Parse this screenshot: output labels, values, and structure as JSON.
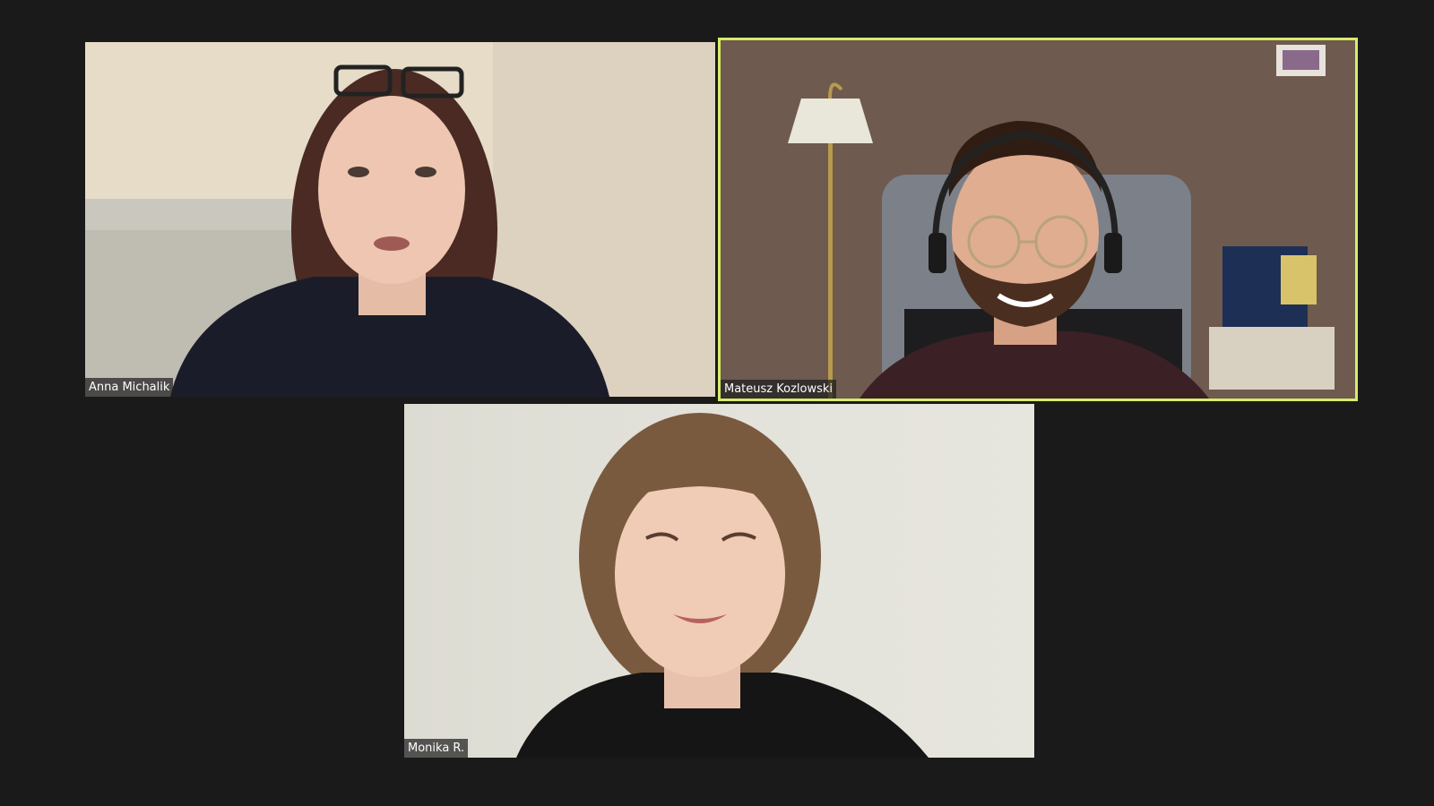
{
  "meeting": {
    "active_speaker_color": "#d6ec6a",
    "background_color": "#1a1a1a",
    "participants": [
      {
        "name": "Anna Michalik",
        "active_speaker": false
      },
      {
        "name": "Mateusz Kozlowski",
        "active_speaker": true
      },
      {
        "name": "Monika R.",
        "active_speaker": false
      }
    ]
  }
}
